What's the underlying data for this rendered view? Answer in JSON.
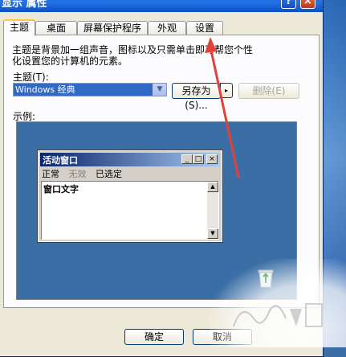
{
  "window": {
    "title": "显示 属性"
  },
  "tabs": [
    {
      "label": "主题",
      "active": true
    },
    {
      "label": "桌面"
    },
    {
      "label": "屏幕保护程序"
    },
    {
      "label": "外观"
    },
    {
      "label": "设置"
    }
  ],
  "theme_tab": {
    "description": "主题是背景加一组声音，图标以及只需单击即可帮您个性化设置您的计算机的元素。",
    "theme_label": "主题(T):",
    "theme_value": "Windows 经典",
    "save_as_label": "另存为(S)...",
    "delete_label": "删除(E)",
    "example_label": "示例:"
  },
  "preview": {
    "window_title": "活动窗口",
    "menu_items": [
      {
        "label": "正常",
        "state": "normal"
      },
      {
        "label": "无效",
        "state": "disabled"
      },
      {
        "label": "已选定",
        "state": "normal"
      }
    ],
    "window_text": "窗口文字"
  },
  "footer": {
    "ok_label": "确定",
    "cancel_label": "取消"
  },
  "colors": {
    "annotation_arrow": "#e0413a",
    "accent": "#316ac5"
  }
}
